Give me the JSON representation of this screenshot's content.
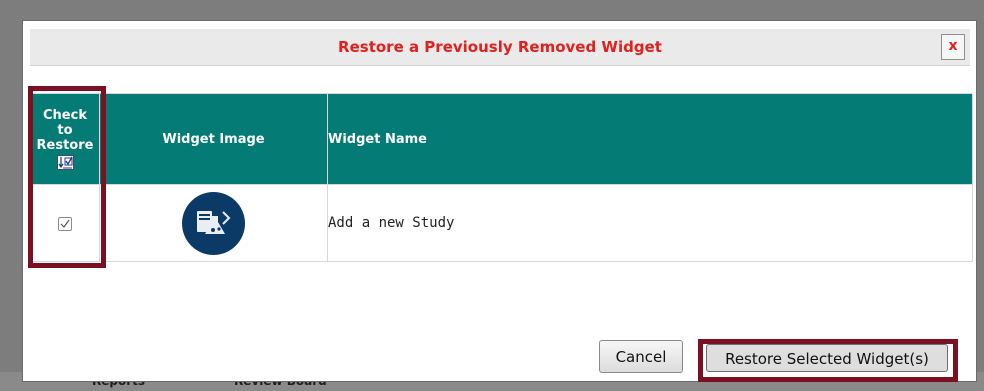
{
  "background": {
    "links": [
      "Reports",
      "Review Board"
    ]
  },
  "dialog": {
    "title": "Restore a Previously Removed Widget",
    "close_label": "x",
    "table": {
      "headers": {
        "check": [
          "Check",
          "to",
          "Restore"
        ],
        "image": "Widget Image",
        "name": "Widget Name"
      },
      "rows": [
        {
          "checked": true,
          "icon": "study-flask-icon",
          "name": "Add a new Study"
        }
      ]
    },
    "buttons": {
      "cancel": "Cancel",
      "restore": "Restore Selected Widget(s)"
    }
  },
  "colors": {
    "title": "#e0211d",
    "header_bg": "#047b75",
    "icon_bg": "#0c3a67",
    "highlight": "#7a1022"
  }
}
